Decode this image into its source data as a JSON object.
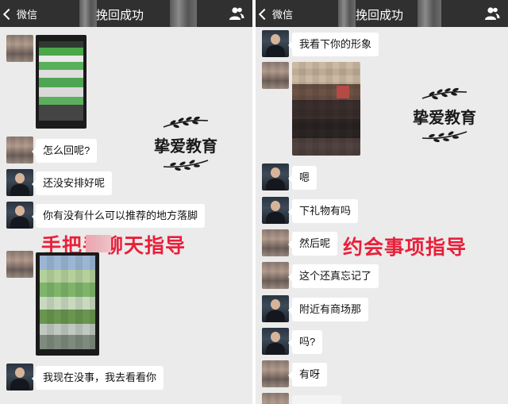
{
  "left_panel": {
    "back_label": "微信",
    "title": "挽回成功",
    "watermark_text": "挚爱教育",
    "overlay_text": "手把手聊天指导",
    "messages": [
      "怎么回呢?",
      "还没安排好呢",
      "你有没有什么可以推荐的地方落脚",
      "我现在没事，我去看看你"
    ]
  },
  "right_panel": {
    "back_label": "微信",
    "title": "挽回成功",
    "watermark_text": "挚爱教育",
    "overlay_text": "约会事项指导",
    "messages": [
      "我看下你的形象",
      "嗯",
      "下礼物有吗",
      "然后呢",
      "这个还真忘记了",
      "附近有商场那",
      "吗?",
      "有呀"
    ]
  },
  "colors": {
    "header": "#303030",
    "chat_background": "#ebebeb",
    "bubble": "#ffffff",
    "overlay_red": "#e8203a"
  },
  "icons": [
    "chevron-left-icon",
    "contacts-icon",
    "laurel-branch-icon"
  ]
}
